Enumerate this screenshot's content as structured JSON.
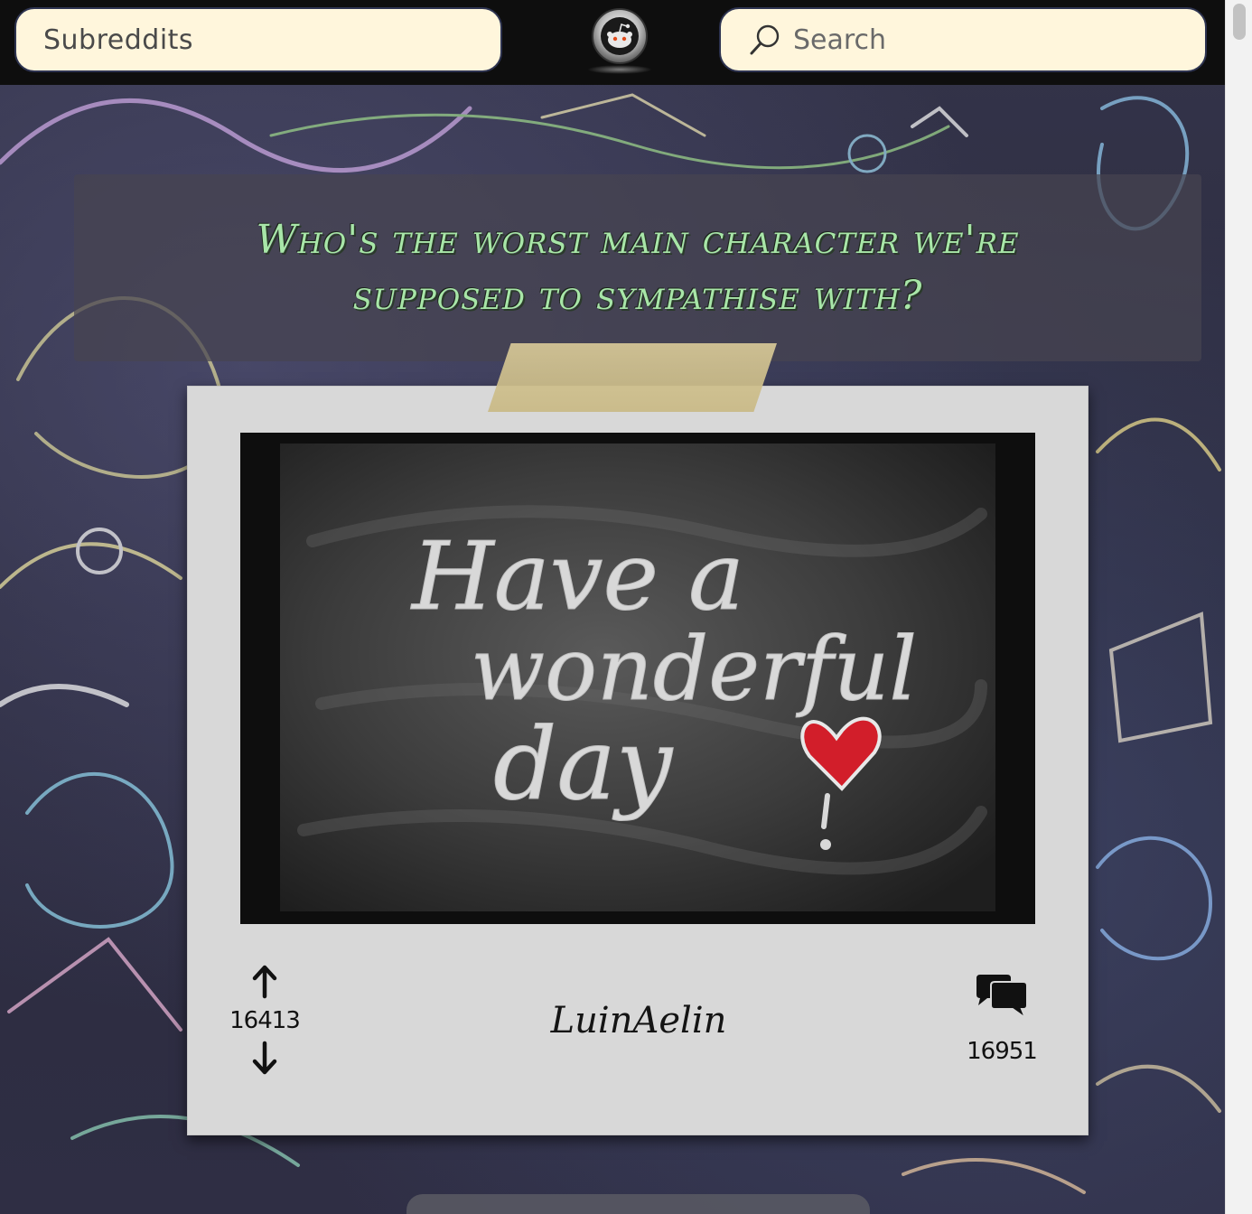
{
  "header": {
    "subreddits_label": "Subreddits",
    "search_placeholder": "Search",
    "logo_icon": "reddit-alien-icon"
  },
  "post": {
    "title": "Who's the worst main character we're supposed to sympathise with?",
    "author": "LuinAelin",
    "upvotes": "16413",
    "comments": "16951",
    "image": {
      "chalk_text_line1": "Have a",
      "chalk_text_line2": "wonderful",
      "chalk_text_line3": "day"
    },
    "icons": {
      "upvote": "arrow-up-icon",
      "downvote": "arrow-down-icon",
      "comments": "speech-bubbles-icon"
    }
  },
  "colors": {
    "header_bg": "#0e0e0e",
    "pill_bg": "#fff6dc",
    "title_color": "#a8e6a8",
    "card_bg": "#d8d8d8"
  }
}
